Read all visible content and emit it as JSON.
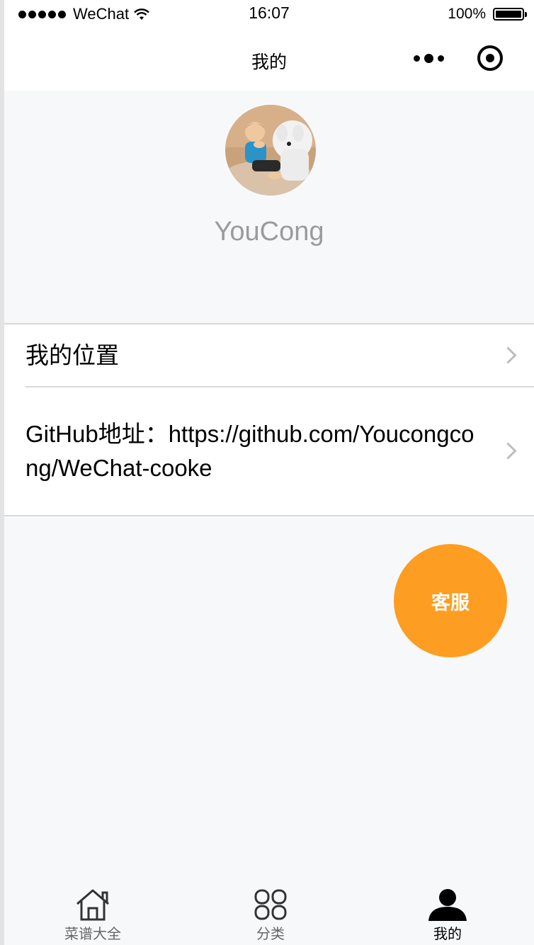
{
  "status_bar": {
    "carrier": "WeChat",
    "time": "16:07",
    "battery": "100%"
  },
  "navbar": {
    "title": "我的",
    "more_icon": "more-dots-icon",
    "close_icon": "target-close-icon"
  },
  "profile": {
    "username": "YouCong",
    "avatar_icon": "avatar-photo"
  },
  "list": {
    "location_label": "我的位置",
    "github_label": "GitHub地址：https://github.com/Youcongcong/WeChat-cooke"
  },
  "service_button": {
    "label": "客服",
    "color": "#fd9d21"
  },
  "tabbar": {
    "tabs": [
      {
        "label": "菜谱大全",
        "icon": "home-icon"
      },
      {
        "label": "分类",
        "icon": "category-grid-icon"
      },
      {
        "label": "我的",
        "icon": "user-icon"
      }
    ],
    "active_index": 2
  }
}
